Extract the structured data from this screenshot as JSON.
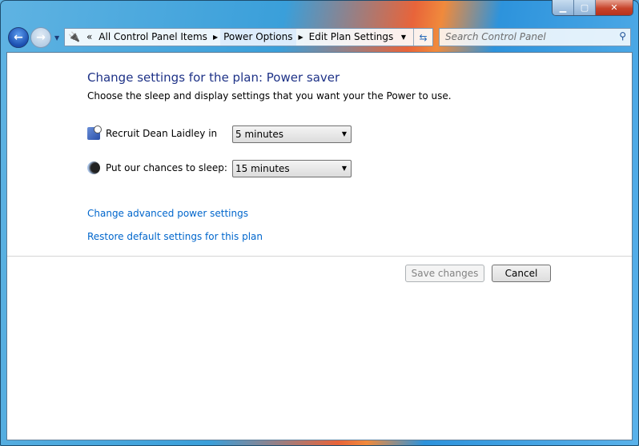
{
  "window": {
    "minimize_icon": "minimize-icon",
    "maximize_icon": "maximize-icon",
    "close_icon": "close-icon"
  },
  "address_bar": {
    "crumbs": [
      "All Control Panel Items",
      "Power Options",
      "Edit Plan Settings"
    ],
    "overflow": "«"
  },
  "search": {
    "placeholder": "Search Control Panel"
  },
  "main": {
    "title": "Change settings for the plan: Power saver",
    "subtitle": "Choose the sleep and display settings that you want your the Power to use.",
    "settings": [
      {
        "label": "Recruit Dean Laidley in",
        "value": "5 minutes",
        "icon": "display-clock-icon"
      },
      {
        "label": "Put  our chances  to sleep:",
        "value": "15 minutes",
        "icon": "sleep-moon-icon"
      }
    ],
    "links": [
      "Change advanced power settings",
      "Restore default settings for this plan"
    ],
    "save_label": "Save changes",
    "cancel_label": "Cancel"
  }
}
